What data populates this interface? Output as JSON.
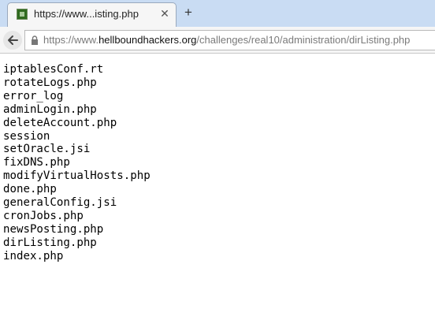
{
  "tab": {
    "title": "https://www...isting.php",
    "close_glyph": "✕",
    "favicon": "site-favicon"
  },
  "new_tab_glyph": "+",
  "address_bar": {
    "prefix": "https://www.",
    "domain": "hellboundhackers.org",
    "path": "/challenges/real10/administration/dirListing.php"
  },
  "files": [
    "iptablesConf.rt",
    "rotateLogs.php",
    "error_log",
    "adminLogin.php",
    "deleteAccount.php",
    "session",
    "setOracle.jsi",
    "fixDNS.php",
    "modifyVirtualHosts.php",
    "done.php",
    "generalConfig.jsi",
    "cronJobs.php",
    "newsPosting.php",
    "dirListing.php",
    "index.php"
  ]
}
